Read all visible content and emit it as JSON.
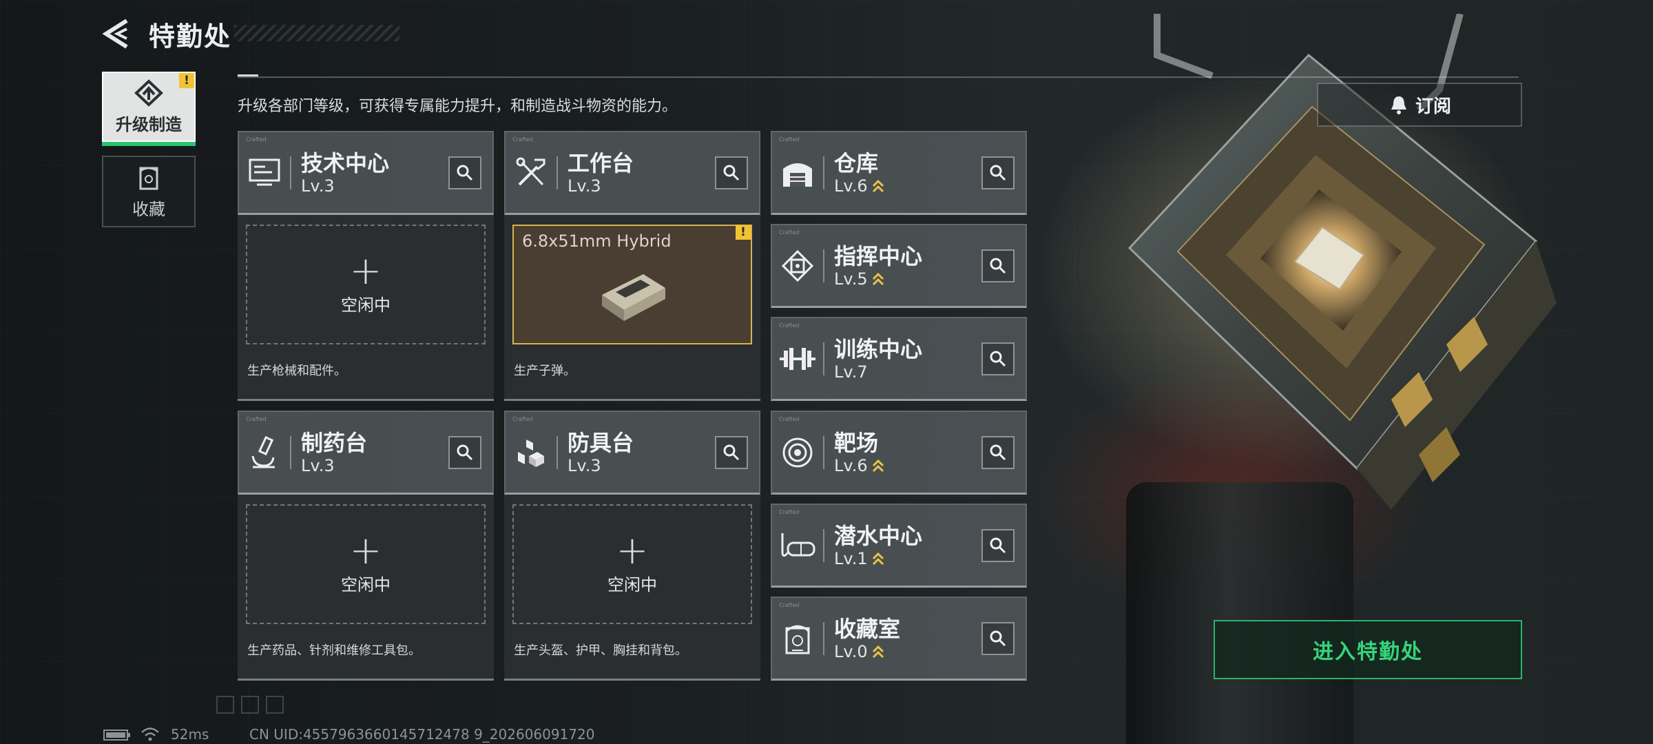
{
  "header": {
    "title": "特勤处",
    "back_icon": "back-arrow-icon"
  },
  "nav": [
    {
      "label": "升级制造",
      "icon": "upgrade-icon",
      "active": true,
      "badge": "!"
    },
    {
      "label": "收藏",
      "icon": "collection-icon",
      "active": false
    }
  ],
  "intro": "升级各部门等级，可获得专属能力提升，和制造战斗物资的能力。",
  "subscribe": {
    "label": "订阅",
    "icon": "bell-icon"
  },
  "departments": [
    {
      "name": "技术中心",
      "level": "Lv.3",
      "icon": "tech-center-icon",
      "upgradable": false
    },
    {
      "name": "工作台",
      "level": "Lv.3",
      "icon": "workbench-icon",
      "upgradable": false
    },
    {
      "name": "仓库",
      "level": "Lv.6",
      "icon": "warehouse-icon",
      "upgradable": true
    },
    {
      "name": "指挥中心",
      "level": "Lv.5",
      "icon": "command-center-icon",
      "upgradable": true
    },
    {
      "name": "训练中心",
      "level": "Lv.7",
      "icon": "training-center-icon",
      "upgradable": false
    },
    {
      "name": "制药台",
      "level": "Lv.3",
      "icon": "pharmacy-icon",
      "upgradable": false
    },
    {
      "name": "防具台",
      "level": "Lv.3",
      "icon": "armor-bench-icon",
      "upgradable": false
    },
    {
      "name": "靶场",
      "level": "Lv.6",
      "icon": "shooting-range-icon",
      "upgradable": true
    },
    {
      "name": "潜水中心",
      "level": "Lv.1",
      "icon": "diving-center-icon",
      "upgradable": true
    },
    {
      "name": "收藏室",
      "level": "Lv.0",
      "icon": "collection-room-icon",
      "upgradable": true
    }
  ],
  "slots": [
    {
      "state": "空闲中",
      "description": "生产枪械和配件。"
    },
    {
      "item": "6.8x51mm Hybrid",
      "description": "生产子弹。",
      "badge": "!"
    },
    {
      "state": "空闲中",
      "description": "生产药品、针剂和维修工具包。"
    },
    {
      "state": "空闲中",
      "description": "生产头盔、护甲、胸挂和背包。"
    }
  ],
  "enter_button": "进入特勤处",
  "footer": {
    "ping": "52ms",
    "uid": "CN UID:4557963660145712478 9_202606091720"
  },
  "colors": {
    "accent_green": "#27c46e",
    "warning_yellow": "#f3c232",
    "upgrade_gold": "#e8c44a"
  }
}
